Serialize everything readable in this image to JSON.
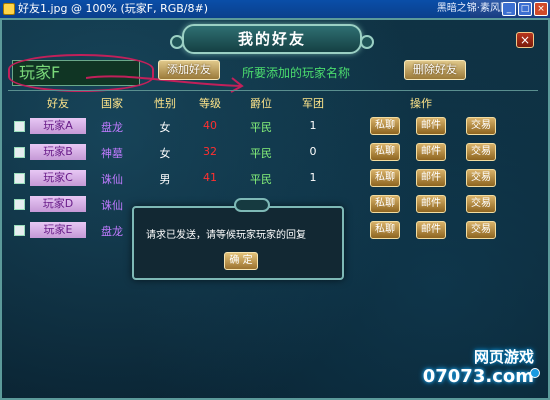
{
  "window": {
    "title": "好友1.jpg @ 100% (玩家F, RGB/8#)",
    "ext_text": "黑暗之锦·素风阵",
    "min": "_",
    "max": "□",
    "close": "×"
  },
  "panel": {
    "title": "我的好友",
    "close_label": "×"
  },
  "search": {
    "value": "玩家F",
    "add_label": "添加好友",
    "hint": "所要添加的玩家名称",
    "delete_label": "删除好友"
  },
  "columns": [
    "好友",
    "国家",
    "性别",
    "等级",
    "爵位",
    "军团",
    "操作"
  ],
  "rows": [
    {
      "name": "玩家A",
      "country": "盘龙",
      "sex": "女",
      "level": "40",
      "rank": "平民",
      "guild": "1"
    },
    {
      "name": "玩家B",
      "country": "神墓",
      "sex": "女",
      "level": "32",
      "rank": "平民",
      "guild": "0"
    },
    {
      "name": "玩家C",
      "country": "诛仙",
      "sex": "男",
      "level": "41",
      "rank": "平民",
      "guild": "1"
    },
    {
      "name": "玩家D",
      "country": "诛仙",
      "sex": "",
      "level": "",
      "rank": "",
      "guild": ""
    },
    {
      "name": "玩家E",
      "country": "盘龙",
      "sex": "",
      "level": "",
      "rank": "",
      "guild": ""
    }
  ],
  "actions": {
    "chat": "私聊",
    "mail": "邮件",
    "trade": "交易"
  },
  "dialog": {
    "message": "请求已发送，请等候玩家玩家的回复",
    "ok_label": "确 定"
  },
  "watermark": {
    "top": "网页游戏",
    "bottom": "07073.com"
  }
}
